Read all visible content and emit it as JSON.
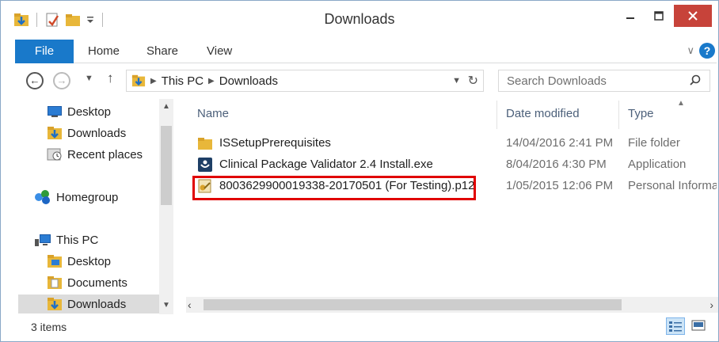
{
  "window": {
    "title": "Downloads"
  },
  "ribbon": {
    "tabs": [
      {
        "label": "File"
      },
      {
        "label": "Home"
      },
      {
        "label": "Share"
      },
      {
        "label": "View"
      }
    ],
    "help_label": "?"
  },
  "nav": {
    "breadcrumb": [
      "This PC",
      "Downloads"
    ],
    "search_placeholder": "Search Downloads"
  },
  "sidebar": {
    "items": [
      {
        "label": "Desktop",
        "icon": "desktop-icon"
      },
      {
        "label": "Downloads",
        "icon": "downloads-folder-icon"
      },
      {
        "label": "Recent places",
        "icon": "recent-places-icon"
      },
      {
        "label": "Homegroup",
        "icon": "homegroup-icon"
      },
      {
        "label": "This PC",
        "icon": "computer-icon"
      },
      {
        "label": "Desktop",
        "icon": "desktop-folder-icon"
      },
      {
        "label": "Documents",
        "icon": "documents-folder-icon"
      },
      {
        "label": "Downloads",
        "icon": "downloads-folder-icon",
        "selected": true
      }
    ]
  },
  "columns": {
    "name": "Name",
    "date": "Date modified",
    "type": "Type"
  },
  "files": [
    {
      "name": "ISSetupPrerequisites",
      "date": "14/04/2016 2:41 PM",
      "type": "File folder",
      "icon": "folder-icon"
    },
    {
      "name": "Clinical Package Validator 2.4 Install.exe",
      "date": "8/04/2016 4:30 PM",
      "type": "Application",
      "icon": "installer-app-icon"
    },
    {
      "name": "8003629900019338-20170501 (For Testing).p12",
      "date": "1/05/2015 12:06 PM",
      "type": "Personal Informa",
      "icon": "certificate-file-icon",
      "highlighted": true
    }
  ],
  "status": {
    "item_count": "3 items"
  },
  "colors": {
    "accent": "#1979ca",
    "close": "#c7433a",
    "highlight": "#e00000"
  }
}
